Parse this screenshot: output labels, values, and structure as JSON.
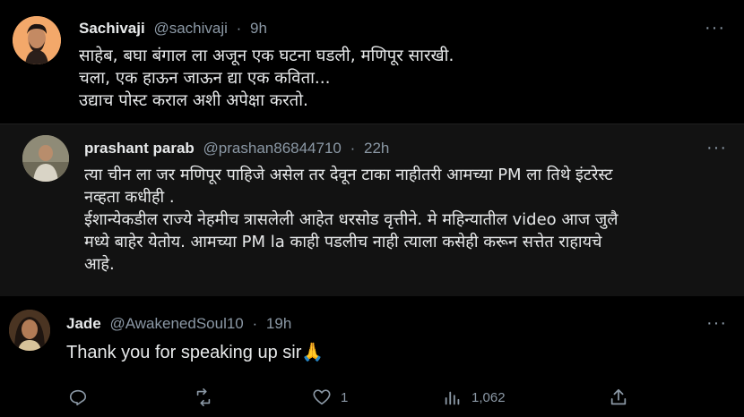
{
  "tweets": [
    {
      "name": "Sachivaji",
      "handle": "@sachivaji",
      "sep": "·",
      "time": "9h",
      "text_lines": [
        "साहेब, बघा बंगाल ला अजून एक घटना घडली, मणिपूर सारखी.",
        "चला, एक हाऊन जाऊन द्या एक कविता...",
        "उद्याच पोस्ट कराल अशी अपेक्षा करतो."
      ],
      "more_icon": "more-horizontal-icon"
    },
    {
      "name": "prashant parab",
      "handle": "@prashan86844710",
      "sep": "·",
      "time": "22h",
      "text_lines": [
        "त्या चीन ला जर मणिपूर पाहिजे असेल तर देवून टाका नाहीतरी आमच्या PM ला तिथे इंटरेस्ट",
        "नव्हता कधीही .",
        "ईशान्येकडील राज्ये नेहमीच त्रासलेली आहेत धरसोड वृत्तीने. मे महिन्यातील video आज जुलै",
        "मध्ये बाहेर येतोय. आमच्या PM la काही पडलीच नाही त्याला कसेही करून सत्तेत राहायचे",
        "आहे."
      ],
      "more_icon": "more-horizontal-icon"
    },
    {
      "name": "Jade",
      "handle": "@AwakenedSoul10",
      "sep": "·",
      "time": "19h",
      "text_lines": [
        "Thank you for speaking up sir🙏"
      ],
      "more_icon": "more-horizontal-icon"
    }
  ],
  "more_label": "···",
  "actions": {
    "reply": {
      "icon": "reply-icon",
      "count": ""
    },
    "retweet": {
      "icon": "retweet-icon",
      "count": ""
    },
    "like": {
      "icon": "heart-icon",
      "count": "1"
    },
    "views": {
      "icon": "analytics-icon",
      "count": "1,062"
    },
    "share": {
      "icon": "share-icon",
      "count": ""
    }
  },
  "colors": {
    "background": "#000000",
    "mid_background": "#121212",
    "text": "#e7e9ea",
    "secondary": "#8b98a5"
  }
}
